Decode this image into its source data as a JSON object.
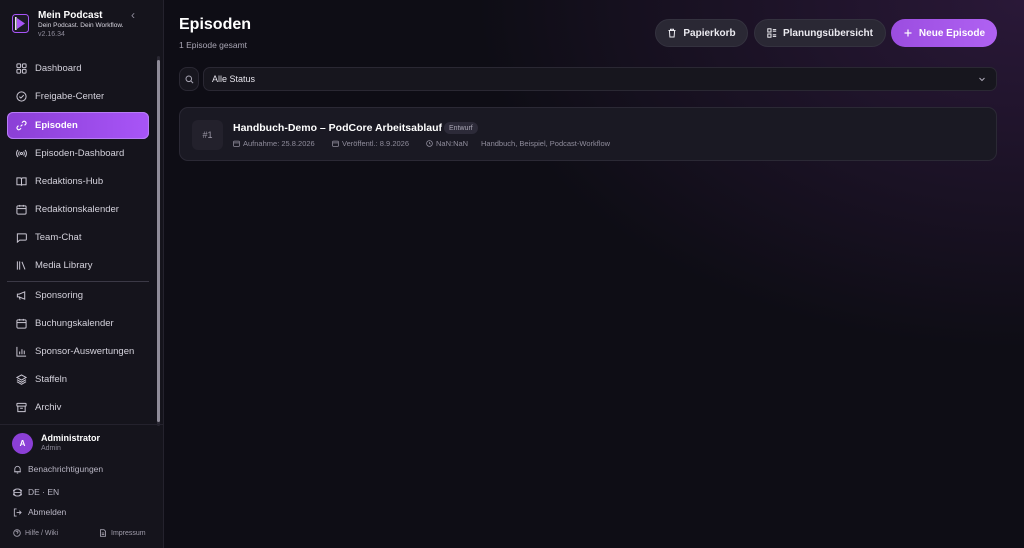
{
  "brand": {
    "title": "Mein Podcast",
    "tagline": "Dein Podcast. Dein Workflow.",
    "version": "v2.16.34",
    "collapse_glyph": "‹"
  },
  "nav": {
    "items": [
      {
        "label": "Dashboard",
        "icon": "dashboard-icon"
      },
      {
        "label": "Freigabe-Center",
        "icon": "check-circle-icon"
      },
      {
        "label": "Episoden",
        "icon": "link-icon",
        "active": true
      },
      {
        "label": "Episoden-Dashboard",
        "icon": "broadcast-icon"
      },
      {
        "label": "Redaktions-Hub",
        "icon": "book-icon"
      },
      {
        "label": "Redaktionskalender",
        "icon": "calendar-icon"
      },
      {
        "label": "Team-Chat",
        "icon": "chat-icon"
      },
      {
        "label": "Media Library",
        "icon": "library-icon"
      },
      {
        "label": "Sponsoring",
        "icon": "megaphone-icon"
      },
      {
        "label": "Buchungskalender",
        "icon": "calendar-icon"
      },
      {
        "label": "Sponsor-Auswertungen",
        "icon": "bar-chart-icon"
      },
      {
        "label": "Staffeln",
        "icon": "layers-icon"
      },
      {
        "label": "Archiv",
        "icon": "archive-icon"
      }
    ]
  },
  "user": {
    "initial": "A",
    "name": "Administrator",
    "role": "Admin"
  },
  "footer": {
    "notifications": "Benachrichtigungen",
    "language": "DE · EN",
    "logout": "Abmelden",
    "help": "Hilfe / Wiki",
    "imprint": "Impressum"
  },
  "header": {
    "title": "Episoden",
    "subtitle": "1 Episode gesamt",
    "trash_label": "Papierkorb",
    "planning_label": "Planungsübersicht",
    "new_label": "Neue Episode"
  },
  "filter": {
    "status_value": "Alle Status"
  },
  "episodes": [
    {
      "number": "#1",
      "title": "Handbuch-Demo – PodCore Arbeitsablauf",
      "status": "Entwurf",
      "recorded": "Aufnahme: 25.8.2026",
      "published": "Veröffentl.: 8.9.2026",
      "duration": "NaN:NaN",
      "tags": "Handbuch, Beispiel, Podcast-Workflow"
    }
  ],
  "colors": {
    "accent": "#a855f7",
    "background": "#0e0d15",
    "sidebar": "#15141c"
  }
}
